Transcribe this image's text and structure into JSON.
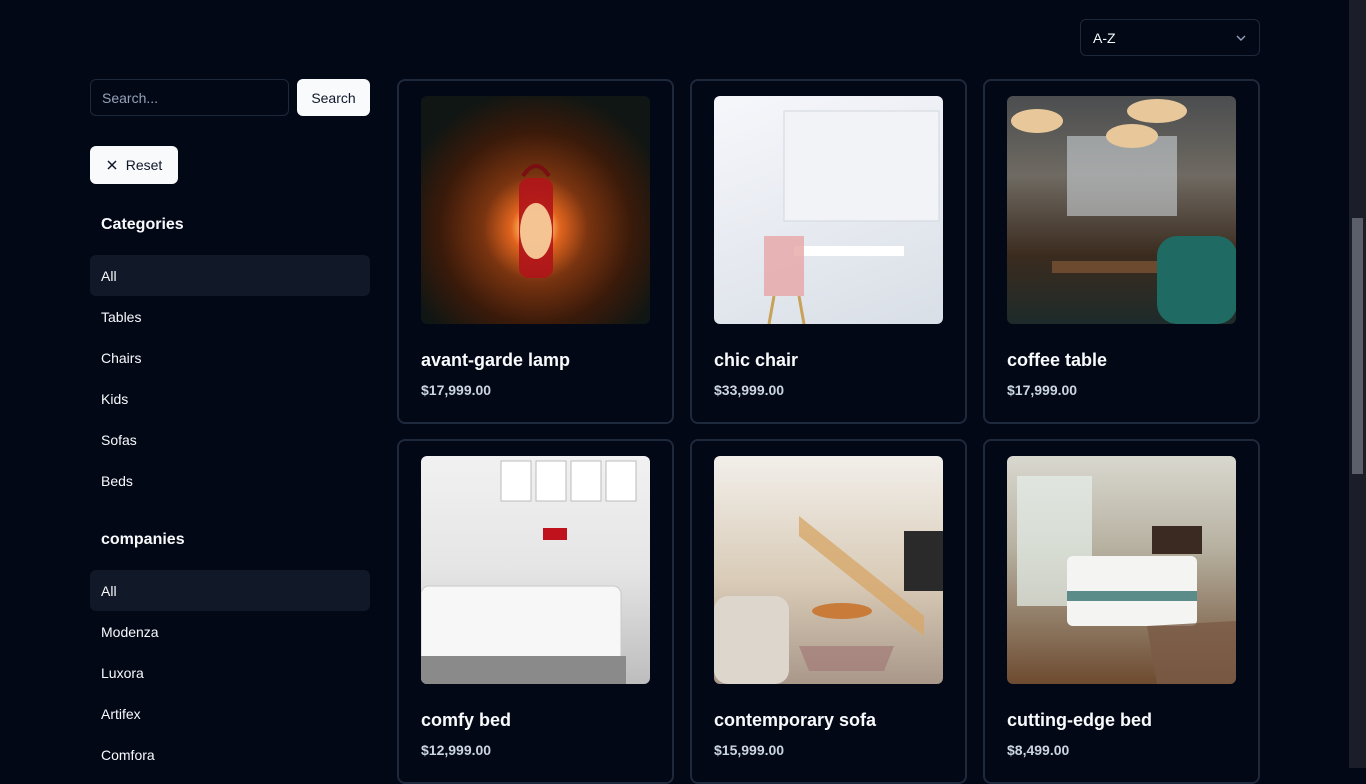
{
  "sort": {
    "selected": "A-Z"
  },
  "search": {
    "placeholder": "Search...",
    "value": "",
    "button_label": "Search"
  },
  "reset": {
    "label": "Reset"
  },
  "categories": {
    "title": "Categories",
    "items": [
      "All",
      "Tables",
      "Chairs",
      "Kids",
      "Sofas",
      "Beds"
    ],
    "active": "All"
  },
  "companies": {
    "title": "companies",
    "items": [
      "All",
      "Modenza",
      "Luxora",
      "Artifex",
      "Comfora"
    ],
    "active": "All"
  },
  "products": [
    {
      "name": "avant-garde lamp",
      "price": "$17,999.00",
      "image": "lamp-photo"
    },
    {
      "name": "chic chair",
      "price": "$33,999.00",
      "image": "chair-photo"
    },
    {
      "name": "coffee table",
      "price": "$17,999.00",
      "image": "cafe-table-photo"
    },
    {
      "name": "comfy bed",
      "price": "$12,999.00",
      "image": "bed-photo"
    },
    {
      "name": "contemporary sofa",
      "price": "$15,999.00",
      "image": "living-room-sofa-photo"
    },
    {
      "name": "cutting-edge bed",
      "price": "$8,499.00",
      "image": "bedroom-photo"
    }
  ]
}
